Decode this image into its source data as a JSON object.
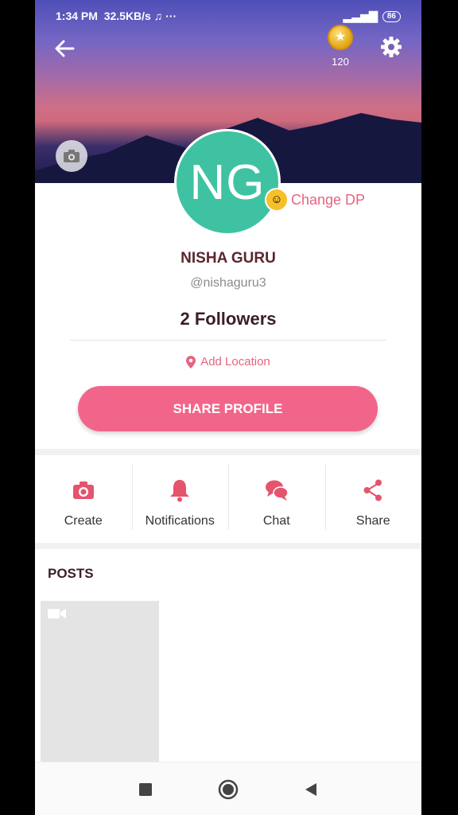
{
  "status_bar": {
    "time": "1:34 PM",
    "network_speed": "32.5KB/s",
    "battery": "86"
  },
  "header": {
    "coins": "120"
  },
  "profile": {
    "initials": "NG",
    "change_dp": "Change DP",
    "name": "NISHA GURU",
    "handle": "@nishaguru3",
    "followers": "2 Followers",
    "add_location": "Add Location",
    "share_profile": "SHARE PROFILE"
  },
  "actions": [
    {
      "label": "Create",
      "icon": "camera-icon"
    },
    {
      "label": "Notifications",
      "icon": "bell-icon"
    },
    {
      "label": "Chat",
      "icon": "chat-icon"
    },
    {
      "label": "Share",
      "icon": "share-icon"
    }
  ],
  "posts": {
    "title": "POSTS"
  },
  "colors": {
    "accent": "#f2658a",
    "avatar": "#3fc2a2",
    "text_dark": "#5a2630"
  }
}
